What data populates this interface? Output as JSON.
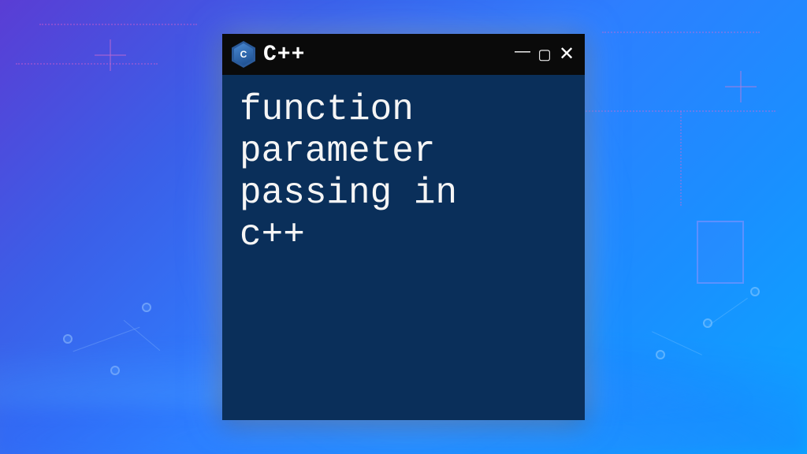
{
  "window": {
    "icon_letter": "C",
    "title": "C++",
    "body_text": "function\nparameter\npassing in\nc++"
  },
  "controls": {
    "minimize": "—",
    "maximize": "▢",
    "close": "✕"
  }
}
